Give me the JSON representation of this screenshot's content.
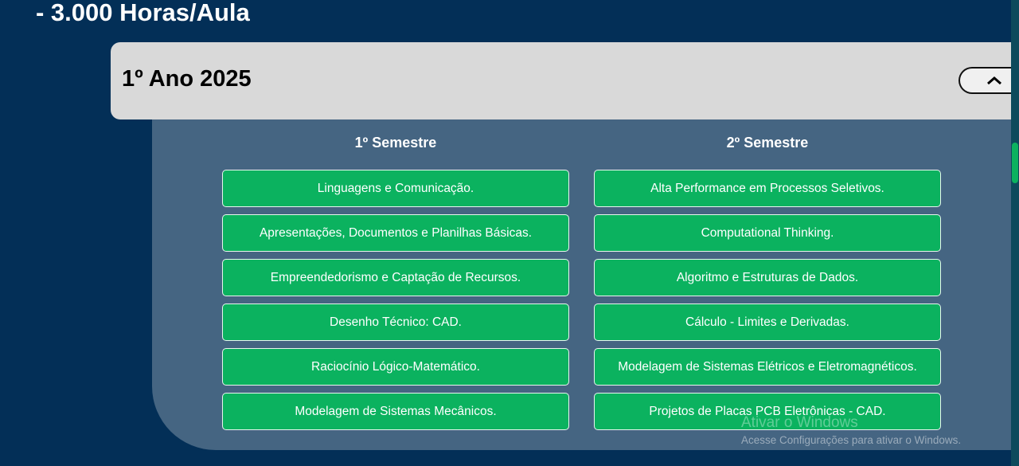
{
  "hours": "- 3.000 Horas/Aula",
  "year": {
    "title": "1º Ano 2025",
    "toggle_icon": "chevron-up-icon"
  },
  "semesters": [
    {
      "title": "1º Semestre",
      "courses": [
        "Linguagens e Comunicação.",
        "Apresentações, Documentos e Planilhas Básicas.",
        "Empreendedorismo e Captação de Recursos.",
        "Desenho Técnico: CAD.",
        "Raciocínio Lógico-Matemático.",
        "Modelagem de Sistemas Mecânicos."
      ]
    },
    {
      "title": "2º Semestre",
      "courses": [
        "Alta Performance em Processos Seletivos.",
        "Computational Thinking.",
        "Algoritmo e Estruturas de Dados.",
        "Cálculo - Limites e Derivadas.",
        "Modelagem de Sistemas Elétricos e Eletromagnéticos.",
        "Projetos de Placas PCB Eletrônicas - CAD."
      ]
    }
  ],
  "watermark": {
    "title": "Ativar o Windows",
    "subtitle": "Acesse Configurações para ativar o Windows."
  }
}
